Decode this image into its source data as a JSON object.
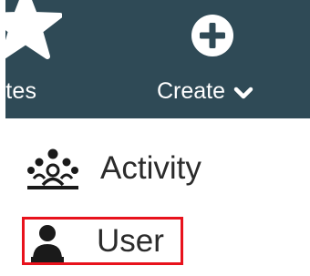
{
  "navbar": {
    "favorites_label": "rites",
    "create_label": "Create"
  },
  "menu": {
    "items": [
      {
        "label": "Activity",
        "icon": "activity-group-icon"
      },
      {
        "label": "User",
        "icon": "user-icon",
        "highlight_color": "#e8121c"
      }
    ]
  },
  "colors": {
    "navbar_background": "#2f4a56",
    "navbar_text": "#ffffff",
    "menu_text": "#2b2b2b"
  }
}
